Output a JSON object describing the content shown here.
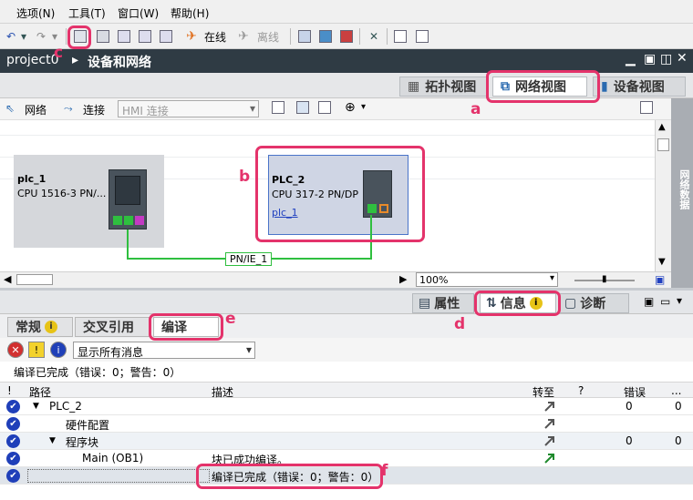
{
  "menu": {
    "items": [
      "选项(N)",
      "工具(T)",
      "窗口(W)",
      "帮助(H)"
    ]
  },
  "toolbar": {
    "online_label": "在线",
    "offline_label": "离线"
  },
  "title": {
    "project": "project0",
    "path": "设备和网络"
  },
  "view_tabs": {
    "topology": "拓扑视图",
    "network": "网络视图",
    "device": "设备视图"
  },
  "net_toolbar": {
    "network_label": "网络",
    "connect_label": "连接",
    "hmi_placeholder": "HMI 连接"
  },
  "devices": {
    "plc1": {
      "name": "plc_1",
      "type": "CPU 1516-3 PN/..."
    },
    "plc2": {
      "name": "PLC_2",
      "type": "CPU 317-2 PN/DP",
      "link": "plc_1"
    }
  },
  "network_label": "PN/IE_1",
  "zoom": "100%",
  "side_panel_label": "网络数据",
  "inspector_tabs": {
    "properties": "属性",
    "info": "信息",
    "diagnostics": "诊断"
  },
  "sub_tabs": {
    "general": "常规",
    "crossref": "交叉引用",
    "compile": "编译"
  },
  "filter": {
    "value": "显示所有消息"
  },
  "status_text": "编译已完成（错误：0；警告：0）",
  "table": {
    "headers": {
      "excl": "!",
      "path": "路径",
      "desc": "描述",
      "goto": "转至",
      "q": "?",
      "errors": "错误",
      "more": "..."
    },
    "rows": [
      {
        "path": "PLC_2",
        "desc": "",
        "errors": "0",
        "warnings": "0"
      },
      {
        "path": "硬件配置",
        "desc": "",
        "errors": "",
        "warnings": ""
      },
      {
        "path": "程序块",
        "desc": "",
        "errors": "0",
        "warnings": "0"
      },
      {
        "path": "Main (OB1)",
        "desc": "块已成功编译。",
        "errors": "",
        "warnings": ""
      },
      {
        "path": "",
        "desc": "编译已完成（错误：0；警告：0）",
        "errors": "",
        "warnings": ""
      }
    ]
  },
  "annotations": {
    "a": "a",
    "b": "b",
    "c": "c",
    "d": "d",
    "e": "e",
    "f": "f"
  },
  "colors": {
    "highlight": "#e4336b",
    "title_bg": "#2f3b44",
    "network_line": "#2fbf3f",
    "check_blue": "#1f3fb9"
  }
}
